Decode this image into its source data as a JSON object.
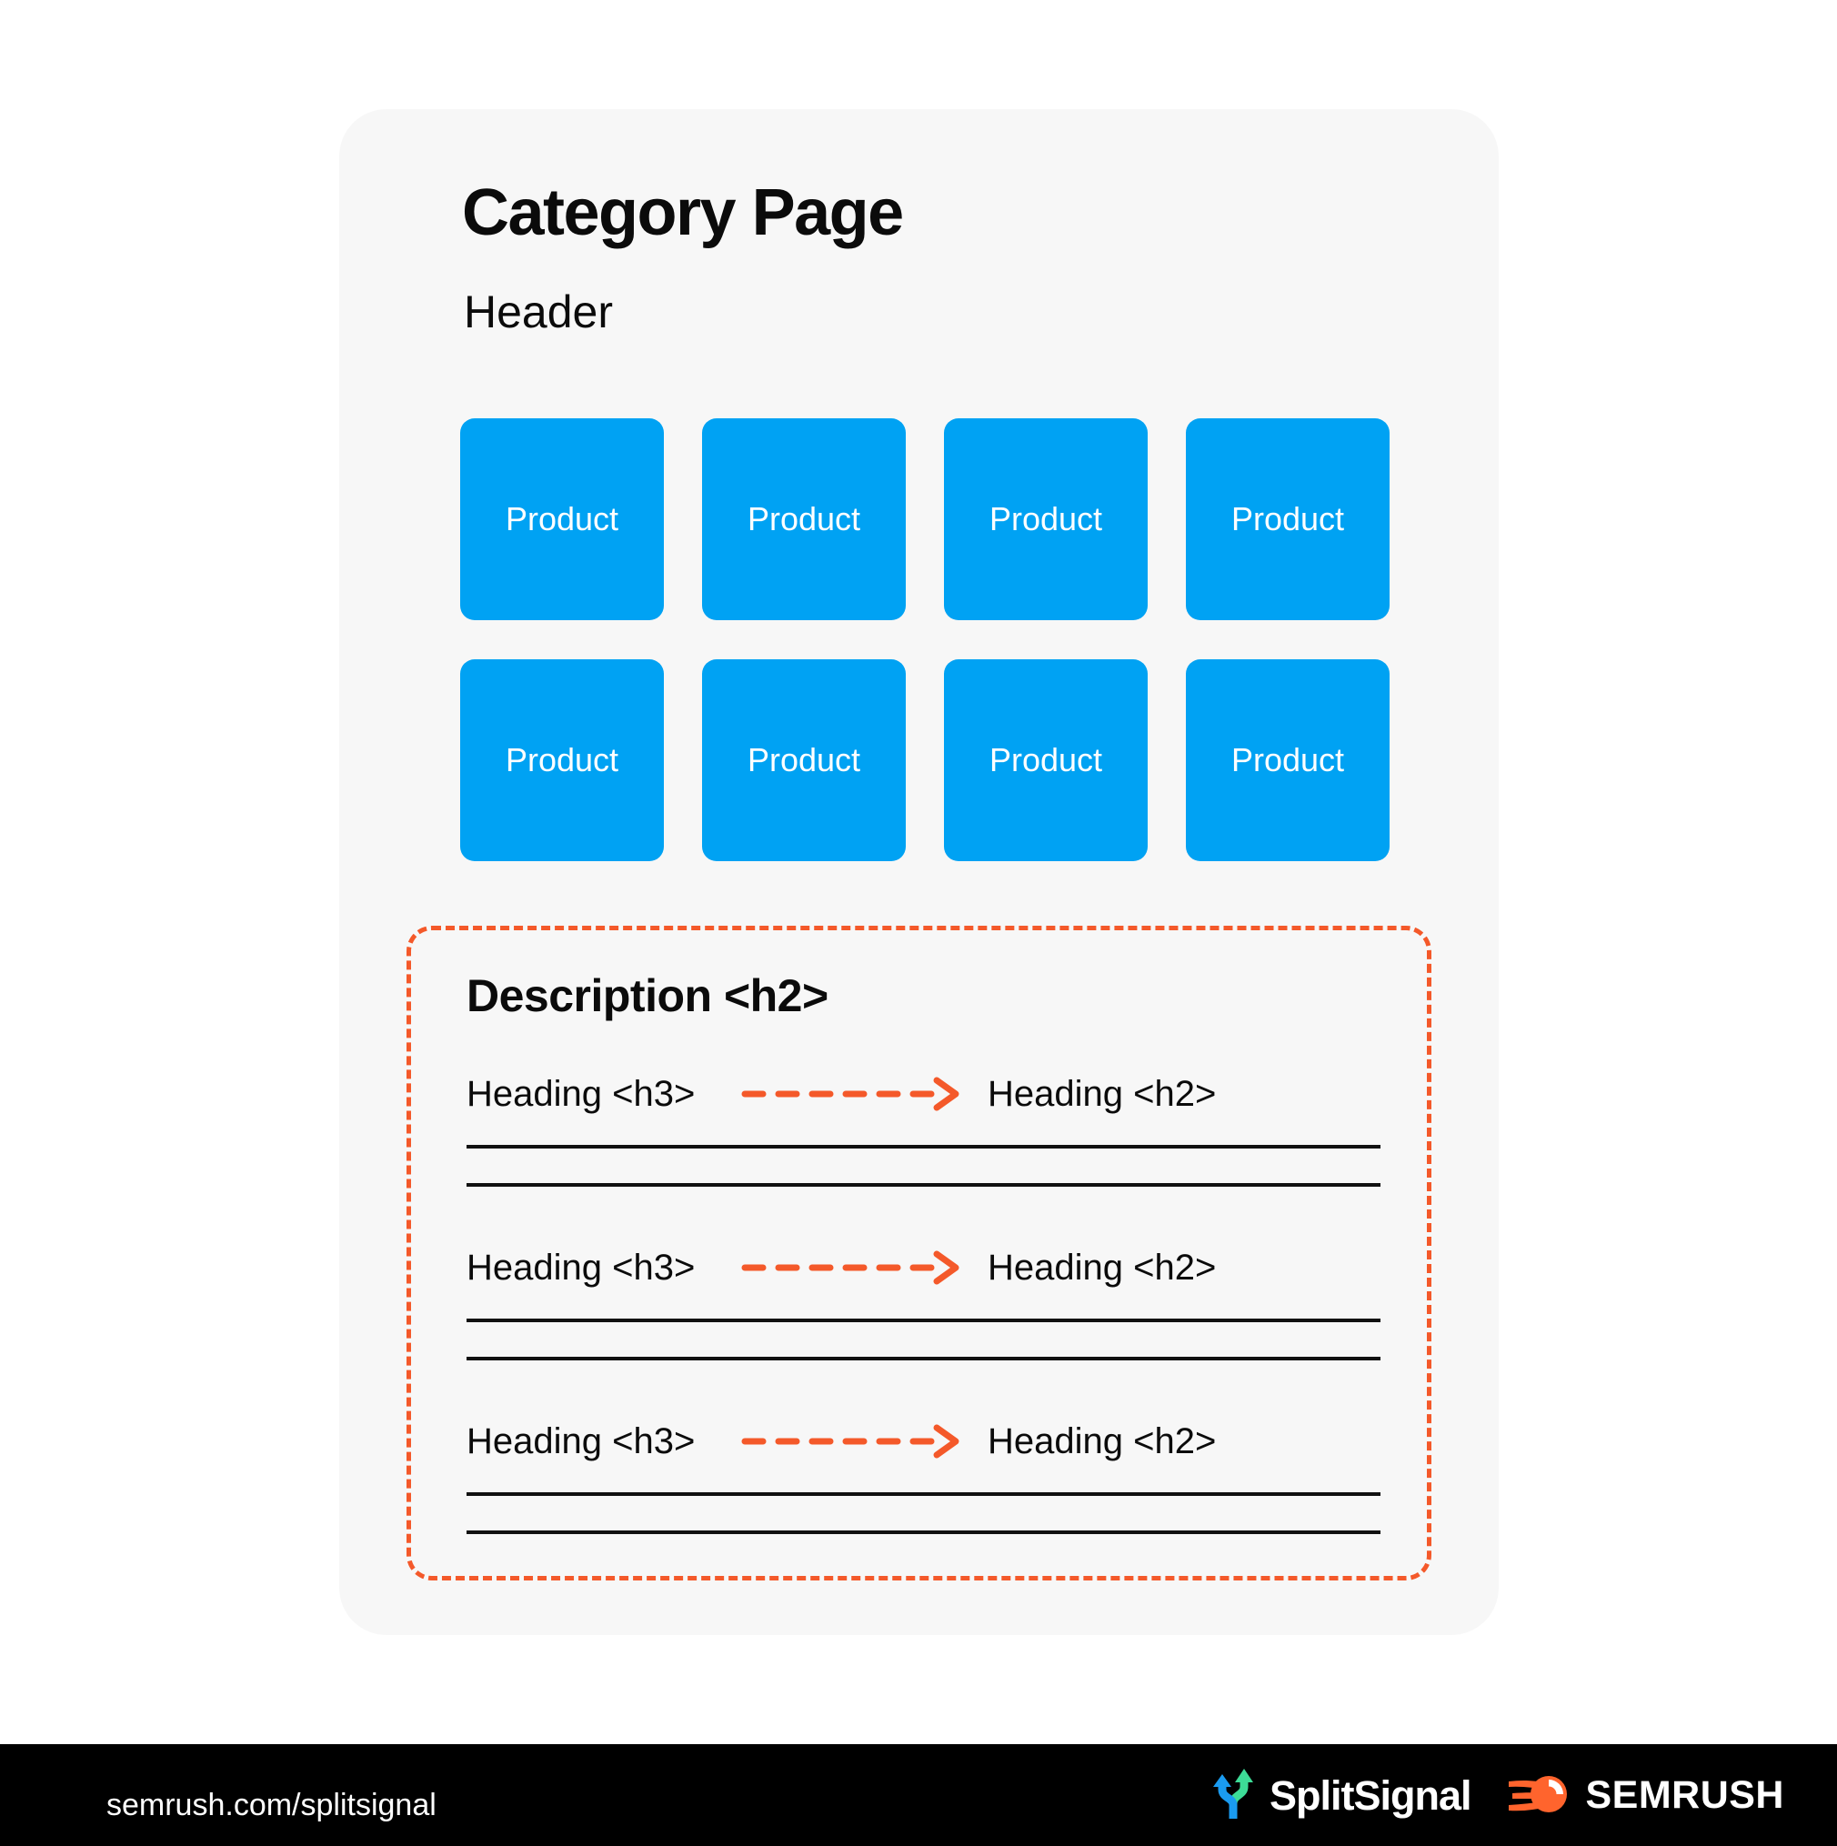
{
  "colors": {
    "page_background": "#ffffff",
    "card_background": "#f7f7f7",
    "product_tile": "#00a2f3",
    "dashed_accent": "#f4592a",
    "rule_line": "#111111",
    "footer_background": "#000000",
    "text_primary": "#0b0b0b",
    "text_inverse": "#ffffff",
    "splitsignal_blue": "#1a9bf0",
    "splitsignal_green": "#3ddc97",
    "semrush_orange": "#ff642d"
  },
  "card": {
    "title": "Category Page",
    "subtitle": "Header",
    "product_rows": [
      [
        {
          "label": "Product"
        },
        {
          "label": "Product"
        },
        {
          "label": "Product"
        },
        {
          "label": "Product"
        }
      ],
      [
        {
          "label": "Product"
        },
        {
          "label": "Product"
        },
        {
          "label": "Product"
        },
        {
          "label": "Product"
        }
      ]
    ],
    "description": {
      "title": "Description <h2>",
      "blocks": [
        {
          "source_heading": "Heading <h3>",
          "target_heading": "Heading <h2>",
          "arrow": "dashed-arrow-right-icon",
          "rule_count": 2
        },
        {
          "source_heading": "Heading <h3>",
          "target_heading": "Heading <h2>",
          "arrow": "dashed-arrow-right-icon",
          "rule_count": 2
        },
        {
          "source_heading": "Heading <h3>",
          "target_heading": "Heading <h2>",
          "arrow": "dashed-arrow-right-icon",
          "rule_count": 2
        }
      ]
    }
  },
  "footer": {
    "url": "semrush.com/splitsignal",
    "logos": [
      {
        "icon": "splitsignal-fork-arrows-icon",
        "wordmark": "SplitSignal"
      },
      {
        "icon": "semrush-comet-icon",
        "wordmark": "SEMRUSH"
      }
    ]
  }
}
